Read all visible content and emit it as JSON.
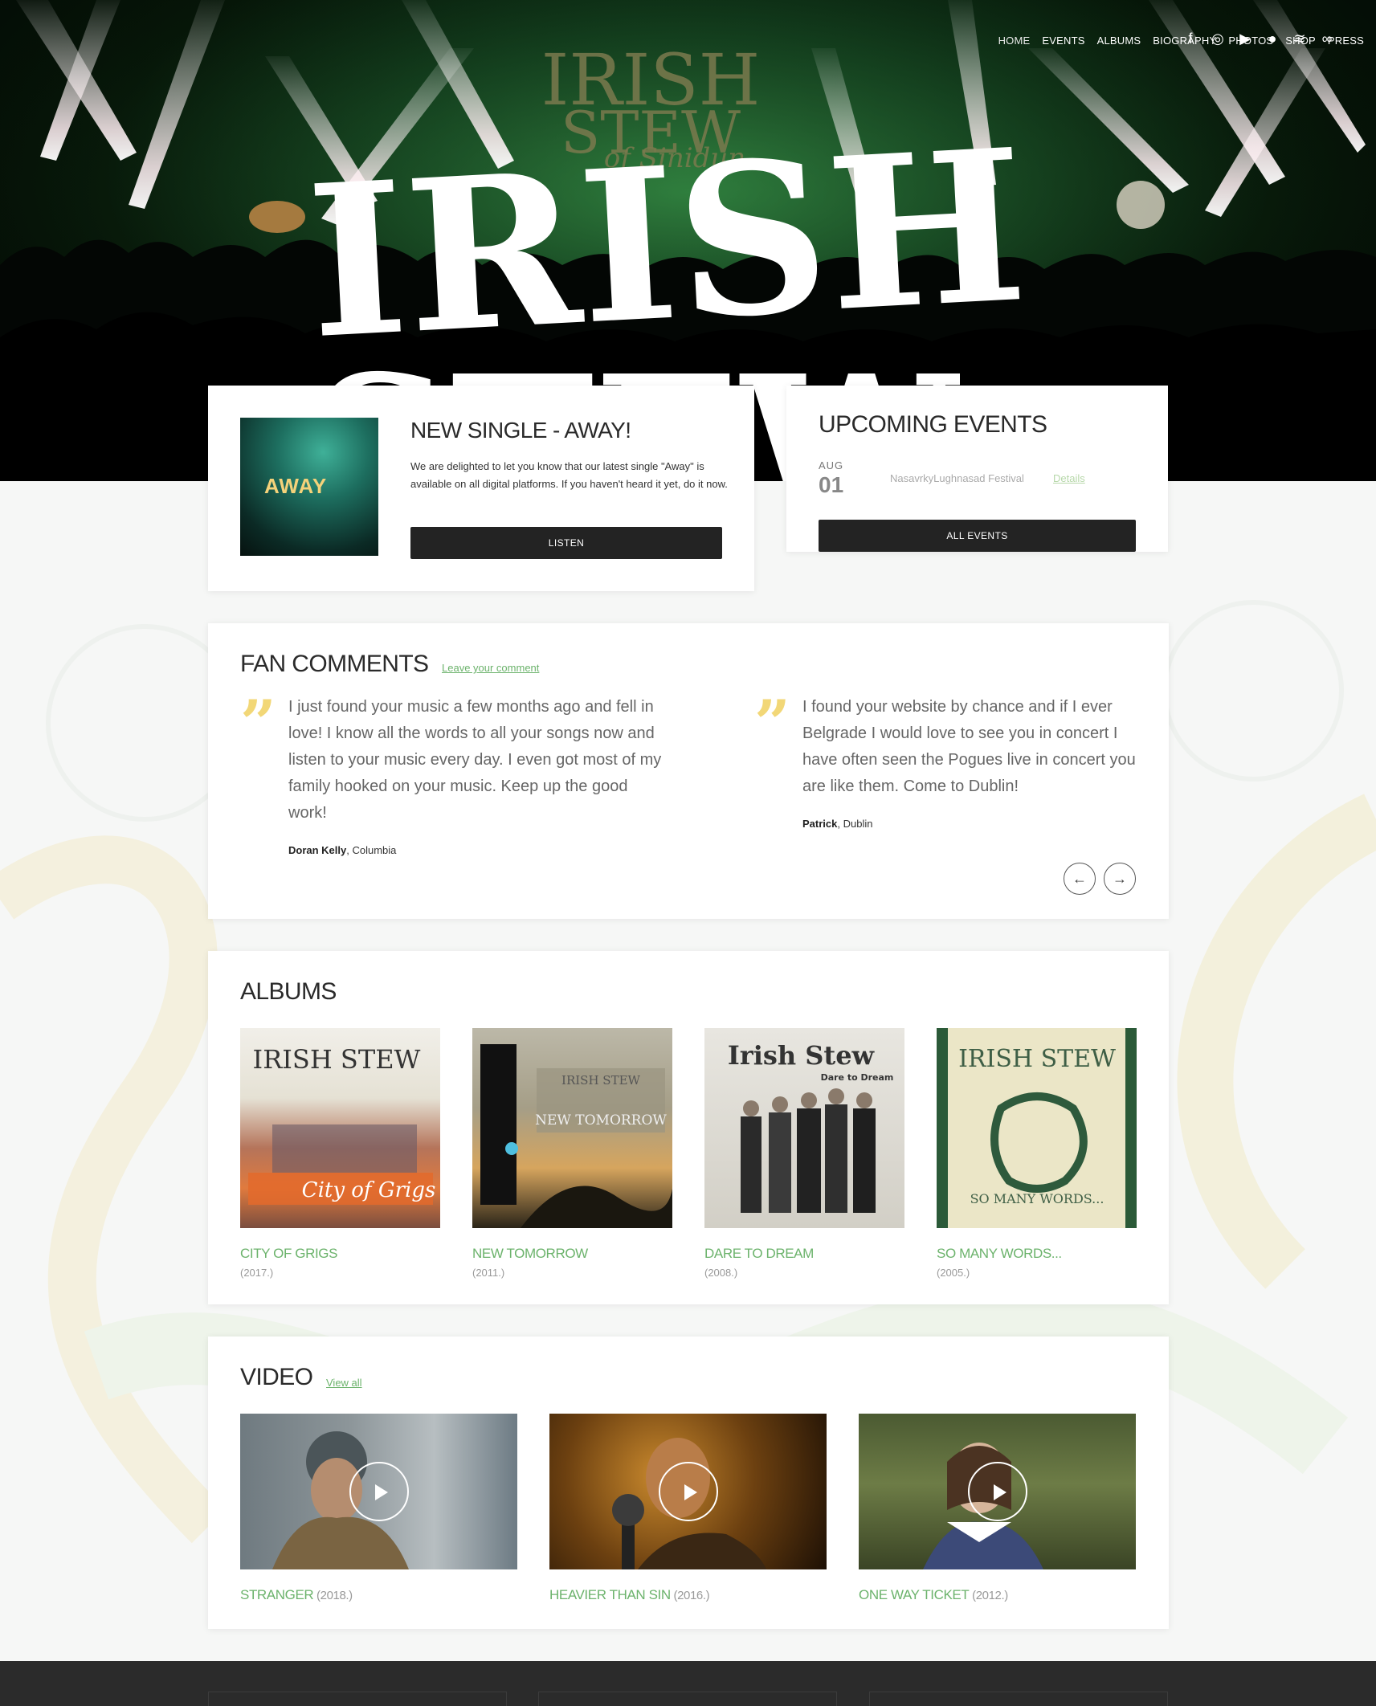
{
  "nav": {
    "items": [
      "HOME",
      "EVENTS",
      "ALBUMS",
      "BIOGRAPHY",
      "PHOTOS",
      "SHOP",
      "PRESS"
    ],
    "icons": [
      "facebook-icon",
      "instagram-icon",
      "youtube-icon",
      "apple-icon",
      "spotify-icon",
      "lastfm-icon"
    ]
  },
  "hero": {
    "logo_line1": "IRISH",
    "logo_line2": "STEW",
    "backdrop_line1": "IRISH",
    "backdrop_line2": "STEW",
    "backdrop_line3": "of Sinidun"
  },
  "single": {
    "cover_text": "AWAY",
    "title": "NEW SINGLE - AWAY!",
    "body": "We are delighted to let you know that our latest single \"Away\" is available on all digital platforms. If you haven't heard it yet, do it now.",
    "button": "LISTEN"
  },
  "events": {
    "title": "UPCOMING EVENTS",
    "list": [
      {
        "month": "AUG",
        "day": "01",
        "venue": "NasavrkyLughnasad Festival",
        "details": "Details"
      }
    ],
    "button": "ALL EVENTS"
  },
  "comments": {
    "title": "FAN COMMENTS",
    "leave_link": "Leave your comment",
    "items": [
      {
        "text": "I just found your music a few months ago and fell in love! I know all the words to all your songs now and listen to your music every day. I even got most of my family hooked on your music. Keep up the good work!",
        "author": "Doran Kelly",
        "location": ", Columbia"
      },
      {
        "text": "I found your website by chance and if I ever Belgrade I would love to see you in concert I have often seen the Pogues live in concert you are like them. Come to Dublin!",
        "author": "Patrick",
        "location": ", Dublin"
      }
    ],
    "prev": "←",
    "next": "→"
  },
  "albums": {
    "title": "ALBUMS",
    "items": [
      {
        "name": "CITY OF GRIGS",
        "year": "(2017.)",
        "art_text1": "IRISH STEW",
        "art_text2": "City of Grigs"
      },
      {
        "name": "NEW TOMORROW",
        "year": "(2011.)",
        "art_text1": "IRISH STEW",
        "art_text2": "NEW TOMORROW"
      },
      {
        "name": "DARE TO DREAM",
        "year": "(2008.)",
        "art_text1": "Irish Stew",
        "art_text2": "Dare to Dream"
      },
      {
        "name": "SO MANY WORDS...",
        "year": "(2005.)",
        "art_text1": "IRISH STEW",
        "art_text2": "SO MANY WORDS..."
      }
    ]
  },
  "video": {
    "title": "VIDEO",
    "view_all": "View all",
    "items": [
      {
        "name": "STRANGER",
        "year": " (2018.)"
      },
      {
        "name": "HEAVIER THAN SIN",
        "year": " (2016.)"
      },
      {
        "name": "ONE WAY TICKET",
        "year": " (2012.)"
      }
    ]
  },
  "colors": {
    "accent_green": "#6cb36c",
    "button_dark": "#232323",
    "quote_yellow": "#f2d777",
    "footer": "#2b2b2b"
  }
}
